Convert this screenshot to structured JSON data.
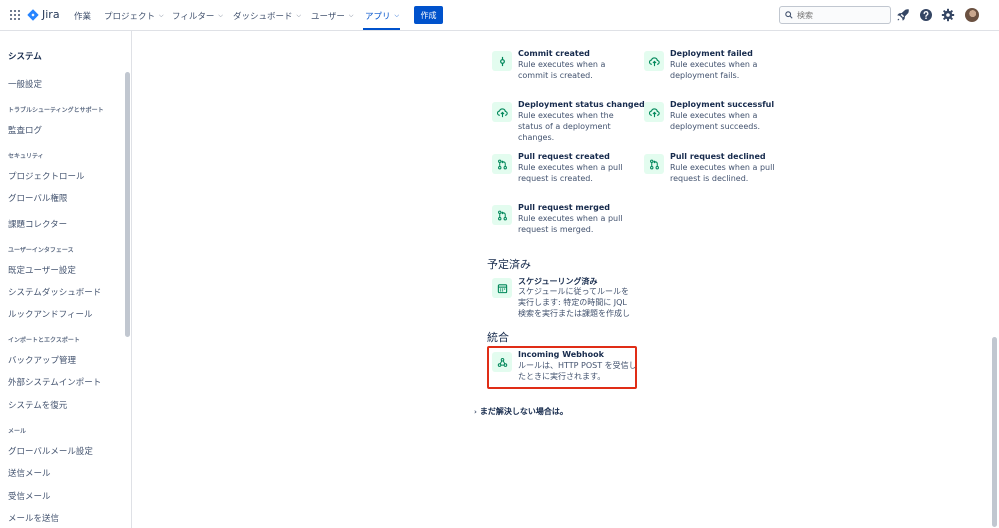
{
  "topnav": {
    "app_name": "Jira",
    "items": [
      {
        "label": "作業",
        "has_dropdown": false
      },
      {
        "label": "プロジェクト",
        "has_dropdown": true
      },
      {
        "label": "フィルター",
        "has_dropdown": true
      },
      {
        "label": "ダッシュボード",
        "has_dropdown": true
      },
      {
        "label": "ユーザー",
        "has_dropdown": true
      },
      {
        "label": "アプリ",
        "has_dropdown": true,
        "active": true
      }
    ],
    "create_label": "作成",
    "search_placeholder": "検索",
    "icons": [
      "app-switcher-icon",
      "notifications-icon",
      "help-icon",
      "settings-icon",
      "avatar"
    ]
  },
  "sidebar": {
    "title": "システム",
    "entries": [
      {
        "type": "item",
        "label": "一般設定"
      },
      {
        "type": "section",
        "label": "トラブルシューティングとサポート"
      },
      {
        "type": "item",
        "label": "監査ログ"
      },
      {
        "type": "section",
        "label": "セキュリティ"
      },
      {
        "type": "item",
        "label": "プロジェクトロール"
      },
      {
        "type": "item",
        "label": "グローバル権限"
      },
      {
        "type": "item",
        "label": "課題コレクター"
      },
      {
        "type": "section",
        "label": "ユーザーインタフェース"
      },
      {
        "type": "item",
        "label": "既定ユーザー設定"
      },
      {
        "type": "item",
        "label": "システムダッシュボード"
      },
      {
        "type": "item",
        "label": "ルックアンドフィール"
      },
      {
        "type": "section",
        "label": "インポートとエクスポート"
      },
      {
        "type": "item",
        "label": "バックアップ管理"
      },
      {
        "type": "item",
        "label": "外部システムインポート"
      },
      {
        "type": "item",
        "label": "システムを復元"
      },
      {
        "type": "section",
        "label": "メール"
      },
      {
        "type": "item",
        "label": "グローバルメール設定"
      },
      {
        "type": "item",
        "label": "送信メール"
      },
      {
        "type": "item",
        "label": "受信メール"
      },
      {
        "type": "item",
        "label": "メールを送信"
      }
    ]
  },
  "main": {
    "dev_triggers": [
      {
        "name": "Commit created",
        "desc": "Rule executes when a commit is created.",
        "icon": "commit-icon"
      },
      {
        "name": "Deployment failed",
        "desc": "Rule executes when a deployment fails.",
        "icon": "cloud-upload-icon"
      },
      {
        "name": "Deployment status changed",
        "desc": "Rule executes when the status of a deployment changes.",
        "icon": "cloud-upload-icon"
      },
      {
        "name": "Deployment successful",
        "desc": "Rule executes when a deployment succeeds.",
        "icon": "cloud-upload-icon"
      },
      {
        "name": "Pull request created",
        "desc": "Rule executes when a pull request is created.",
        "icon": "pull-request-icon"
      },
      {
        "name": "Pull request declined",
        "desc": "Rule executes when a pull request is declined.",
        "icon": "pull-request-icon"
      },
      {
        "name": "Pull request merged",
        "desc": "Rule executes when a pull request is merged.",
        "icon": "pull-request-icon"
      }
    ],
    "scheduled": {
      "heading": "予定済み",
      "name": "スケジューリング済み",
      "desc": "スケジュールに従ってルールを実行します: 特定の時間に JQL 検索を実行または課題を作成し",
      "icon": "calendar-icon"
    },
    "integration": {
      "heading": "統合",
      "name": "Incoming Webhook",
      "desc": "ルールは、HTTP POST を受信したときに実行されます。",
      "icon": "webhook-icon",
      "highlight_color": "#e02d16"
    },
    "help_label": "まだ解決しない場合は。"
  },
  "colors": {
    "accent": "#0052cc",
    "icon_tile": "#e3fcef",
    "icon_green": "#00875a"
  }
}
